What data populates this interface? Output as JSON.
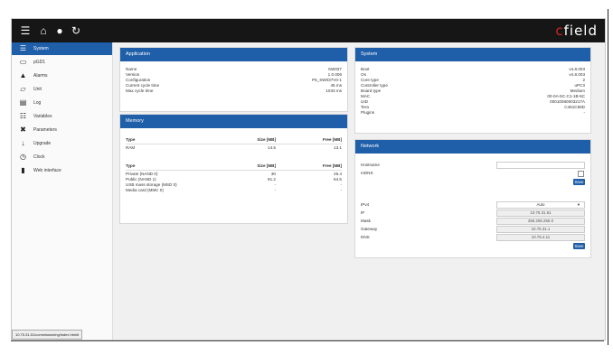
{
  "logo": {
    "c": "c",
    "rest": "field"
  },
  "sidebar": {
    "items": [
      {
        "label": "System",
        "active": true
      },
      {
        "label": "pGD1"
      },
      {
        "label": "Alarms"
      },
      {
        "label": "Unit"
      },
      {
        "label": "Log"
      },
      {
        "label": "Variables"
      },
      {
        "label": "Parameters"
      },
      {
        "label": "Upgrade"
      },
      {
        "label": "Clock"
      },
      {
        "label": "Web interface"
      }
    ]
  },
  "status_url": "10.75.31.51/commissioning/index.html#",
  "application": {
    "title": "Application",
    "rows": [
      {
        "k": "Name",
        "v": "SW037"
      },
      {
        "k": "Version",
        "v": "1.0.006"
      },
      {
        "k": "Configuration",
        "v": "P6_SW037V0-1"
      },
      {
        "k": "Current cycle time",
        "v": "45 ms"
      },
      {
        "k": "Max cycle time",
        "v": "1033 ms"
      }
    ]
  },
  "memory": {
    "title": "Memory",
    "table1": {
      "headers": [
        "Type",
        "Size [MB]",
        "Free [MB]"
      ],
      "rows": [
        [
          "RAM",
          "14.5",
          "13.1"
        ]
      ]
    },
    "table2": {
      "headers": [
        "Type",
        "Size [MB]",
        "Free [MB]"
      ],
      "rows": [
        [
          "Private (NAND 0)",
          "30",
          "26.4"
        ],
        [
          "Public (NAND 1)",
          "91.2",
          "64.5"
        ],
        [
          "USB mass storage (MSD 0)",
          "-",
          "-"
        ],
        [
          "Media card (MMC 0)",
          "-",
          "-"
        ]
      ]
    }
  },
  "system": {
    "title": "System",
    "rows": [
      {
        "k": "Boot",
        "v": "v4.8.003"
      },
      {
        "k": "Os",
        "v": "v4.8.003"
      },
      {
        "k": "Core type",
        "v": "2"
      },
      {
        "k": "Controller type",
        "v": "uPC3"
      },
      {
        "k": "Board type",
        "v": "Medium"
      },
      {
        "k": "MAC",
        "v": "00-0A-5C-C1-1B-5C"
      },
      {
        "k": "UID",
        "v": "00010080003217A"
      },
      {
        "k": "Tera",
        "v": "C461C56D"
      },
      {
        "k": "Plugins",
        "v": "-"
      }
    ]
  },
  "network": {
    "title": "Network",
    "hostname_label": "Hostname",
    "hostname_value": "",
    "mdns_label": "mDNS",
    "save_label": "Save",
    "ipv4_label": "IPv4",
    "ipv4_mode": "Auto",
    "ip_label": "IP",
    "ip_value": "10.75.31.51",
    "mask_label": "Mask",
    "mask_value": "255.255.255.0",
    "gateway_label": "Gateway",
    "gateway_value": "10.75.31.1",
    "dns_label": "DNS",
    "dns_value": "10.75.4.11",
    "save2_label": "Save"
  }
}
